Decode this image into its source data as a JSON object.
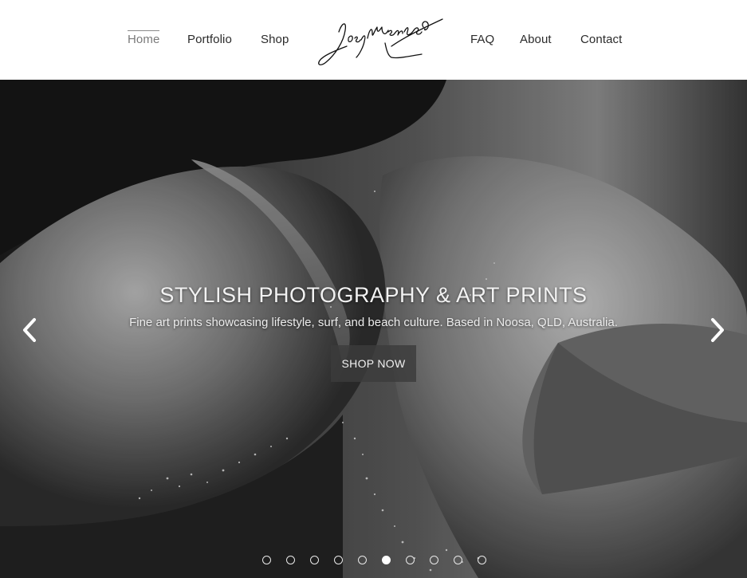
{
  "nav": {
    "left": [
      {
        "label": "Home",
        "active": true
      },
      {
        "label": "Portfolio",
        "active": false
      },
      {
        "label": "Shop",
        "active": false
      }
    ],
    "right": [
      {
        "label": "FAQ",
        "active": false
      },
      {
        "label": "About",
        "active": false
      },
      {
        "label": "Contact",
        "active": false
      }
    ],
    "logo_text": "Josy Menezes"
  },
  "hero": {
    "title": "STYLISH PHOTOGRAPHY & ART PRINTS",
    "subtitle": "Fine art prints showcasing lifestyle, surf, and beach culture. Based in Noosa, QLD, Australia.",
    "cta_label": "SHOP NOW",
    "image": "black-and-white photo of a woman's sandy shoulder and back wearing a swimsuit",
    "slides_total": 10,
    "active_slide": 6
  },
  "icons": {
    "prev": "chevron-left-icon",
    "next": "chevron-right-icon"
  },
  "colors": {
    "header_bg": "#ffffff",
    "nav_text": "#2b2b2b",
    "nav_active": "#7a7a7a",
    "cta_bg": "#3c3c3c",
    "hero_text": "#f2f2f2"
  }
}
